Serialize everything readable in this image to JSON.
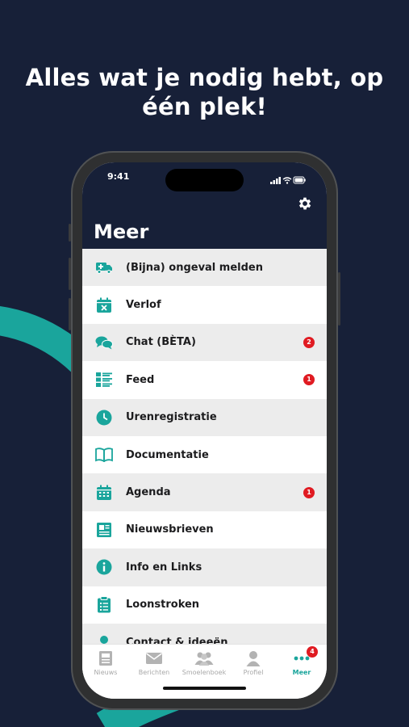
{
  "headline": {
    "line1": "Alles wat je nodig hebt, op",
    "line2": "één plek!"
  },
  "status_bar": {
    "time": "9:41"
  },
  "page": {
    "title": "Meer"
  },
  "colors": {
    "accent": "#1aa59c",
    "header_bg": "#172038",
    "badge": "#e01b22"
  },
  "menu": {
    "items": [
      {
        "label": "(Bijna) ongeval melden",
        "icon": "ambulance-icon",
        "badge": ""
      },
      {
        "label": "Verlof",
        "icon": "calendar-x-icon",
        "badge": ""
      },
      {
        "label": "Chat (BÈTA)",
        "icon": "chat-bubbles-icon",
        "badge": "2"
      },
      {
        "label": "Feed",
        "icon": "feed-list-icon",
        "badge": "1"
      },
      {
        "label": "Urenregistratie",
        "icon": "clock-icon",
        "badge": ""
      },
      {
        "label": "Documentatie",
        "icon": "book-icon",
        "badge": ""
      },
      {
        "label": "Agenda",
        "icon": "calendar-icon",
        "badge": "1"
      },
      {
        "label": "Nieuwsbrieven",
        "icon": "newspaper-icon",
        "badge": ""
      },
      {
        "label": "Info en Links",
        "icon": "info-icon",
        "badge": ""
      },
      {
        "label": "Loonstroken",
        "icon": "clipboard-icon",
        "badge": ""
      },
      {
        "label": "Contact & ideeën",
        "icon": "contact-icon",
        "badge": ""
      }
    ]
  },
  "tabbar": {
    "tabs": [
      {
        "label": "Nieuws",
        "icon": "news-icon"
      },
      {
        "label": "Berichten",
        "icon": "mail-icon"
      },
      {
        "label": "Smoelenboek",
        "icon": "people-icon"
      },
      {
        "label": "Profiel",
        "icon": "person-icon"
      },
      {
        "label": "Meer",
        "icon": "more-dots-icon",
        "badge": "4",
        "active": true
      }
    ]
  }
}
